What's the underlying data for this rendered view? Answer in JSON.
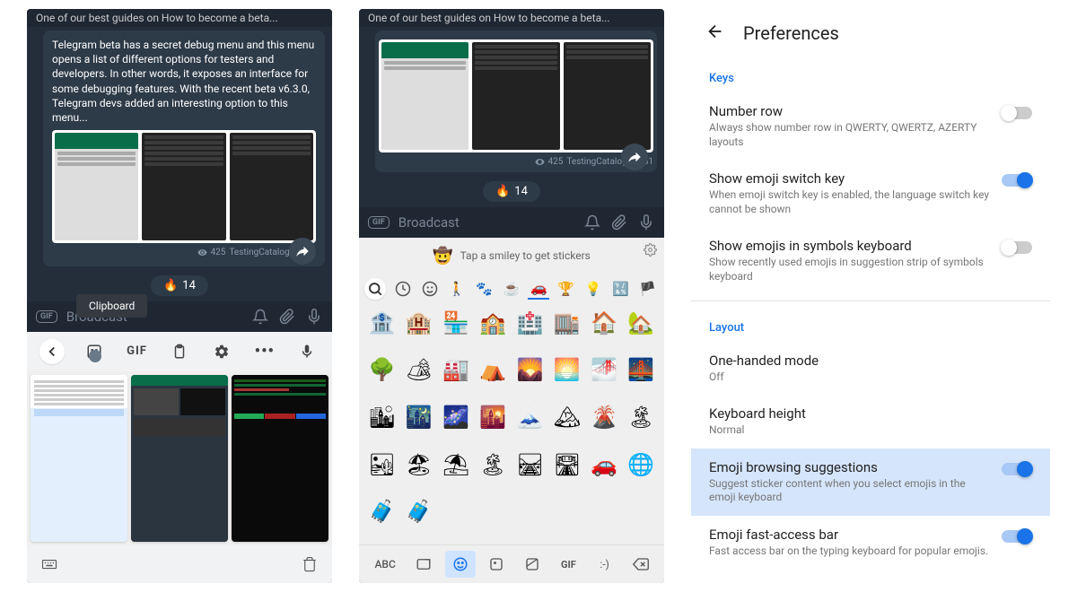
{
  "left": {
    "header_truncated": "One of our best guides on How to become a beta...",
    "message_text": "Telegram beta has a secret debug menu and this menu opens a list of different options for testers and developers. In other words, it exposes an interface for some debugging features. With the recent beta v6.3.0, Telegram devs added an interesting option to this menu...",
    "views": "425",
    "meta": "TestingCatalog, 15:51",
    "reaction_emoji": "🔥",
    "reaction_count": "14",
    "clipboard_tooltip": "Clipboard",
    "input_placeholder": "Broadcast",
    "gif_label": "GIF",
    "toolbar_gif": "GIF"
  },
  "mid": {
    "header_truncated": "One of our best guides on How to become a beta...",
    "views": "425",
    "meta": "TestingCatalog, 15:51",
    "reaction_emoji": "🔥",
    "reaction_count": "14",
    "input_placeholder": "Broadcast",
    "gif_label": "GIF",
    "sticker_hint": "Tap a smiley to get stickers",
    "abc_label": "ABC",
    "gif2": "GIF",
    "emoticon": ":-)",
    "emojis": [
      "🏦",
      "🏨",
      "🏪",
      "🏫",
      "🏥",
      "🏬",
      "🏠",
      "🏡",
      "🌳",
      "🏕",
      "🏭",
      "⛺",
      "🌄",
      "🌅",
      "🌁",
      "🌉",
      "🏙",
      "🌃",
      "🌌",
      "🌇",
      "🗻",
      "🏔",
      "🌋",
      "🏝",
      "🏜",
      "🏖",
      "⛱",
      "🏝",
      "🛤",
      "🛣",
      "🚗",
      "🌐",
      "🧳",
      "🧳"
    ]
  },
  "prefs": {
    "title": "Preferences",
    "section_keys": "Keys",
    "section_layout": "Layout",
    "items": {
      "number_row": {
        "label": "Number row",
        "desc": "Always show number row in QWERTY, QWERTZ, AZERTY layouts"
      },
      "emoji_key": {
        "label": "Show emoji switch key",
        "desc": "When emoji switch key is enabled, the language switch key cannot be shown"
      },
      "emoji_symbols": {
        "label": "Show emojis in symbols keyboard",
        "desc": "Show recently used emojis in suggestion strip of symbols keyboard"
      },
      "one_handed": {
        "label": "One-handed mode",
        "desc": "Off"
      },
      "kb_height": {
        "label": "Keyboard height",
        "desc": "Normal"
      },
      "emoji_browse": {
        "label": "Emoji browsing suggestions",
        "desc": "Suggest sticker content when you select emojis in the emoji keyboard"
      },
      "fast_bar": {
        "label": "Emoji fast-access bar",
        "desc": "Fast access bar on the typing keyboard for popular emojis."
      }
    }
  }
}
